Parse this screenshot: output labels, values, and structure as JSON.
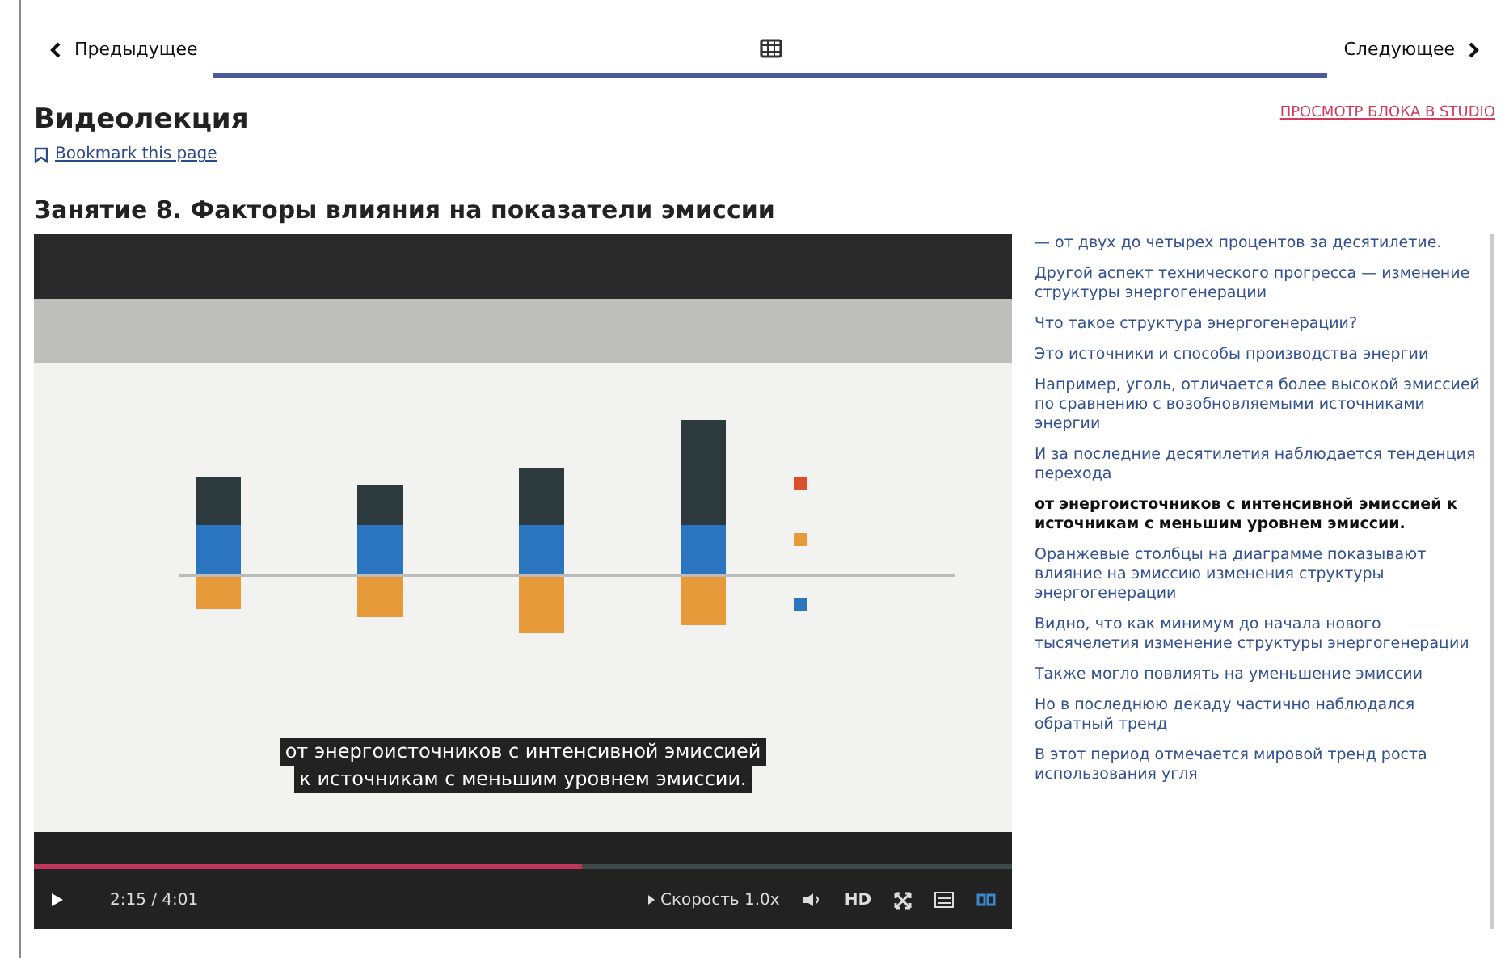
{
  "unit_nav": {
    "previous": "Предыдущее",
    "next": "Следующее",
    "tabs": [
      {
        "kind": "video",
        "selected": true
      }
    ]
  },
  "unit": {
    "title": "Видеолекция",
    "bookmark": "Bookmark this page",
    "studio_link": "ПРОСМОТР БЛОКА В STUDIO"
  },
  "video": {
    "title": "Занятие 8. Факторы влияния на показатели эмиссии",
    "captions": [
      "от энергоисточников с интенсивной эмиссией",
      "к источникам с меньшим уровнем эмиссии."
    ],
    "progress": {
      "level": 0.56
    },
    "controls": {
      "time": "2:15 / 4:01",
      "speed_label": "Скорость",
      "speed": "1.0x",
      "hd": "HD",
      "captions_on": true
    }
  },
  "transcript": [
    {
      "text": "— от двух до четырех процентов за десятилетие.",
      "selected": false
    },
    {
      "text": "Другой аспект технического прогресса — изменение структуры энергогенерации",
      "selected": false
    },
    {
      "text": "Что такое структура энергогенерации?",
      "selected": false
    },
    {
      "text": "Это источники и способы производства энергии",
      "selected": false
    },
    {
      "text": "Например, уголь, отличается более высокой эмиссией по сравнению с возобновляемыми источниками энергии",
      "selected": false
    },
    {
      "text": "И за последние десятилетия наблюдается тенденция перехода",
      "selected": false
    },
    {
      "text": "от энергоисточников с интенсивной эмиссией к источникам с меньшим уровнем эмиссии.",
      "selected": true
    },
    {
      "text": "Оранжевые столбцы на диаграмме показывают влияние на эмиссию изменения структуры энергогенерации",
      "selected": false
    },
    {
      "text": "Видно, что как минимум до начала нового тысячелетия изменение структуры энергогенерации",
      "selected": false
    },
    {
      "text": "Также могло повлиять на уменьшение эмиссии",
      "selected": false
    },
    {
      "text": "Но в последнюю декаду частично наблюдался обратный тренд",
      "selected": false
    },
    {
      "text": "В этот период отмечается мировой тренд роста использования угля",
      "selected": false
    }
  ]
}
